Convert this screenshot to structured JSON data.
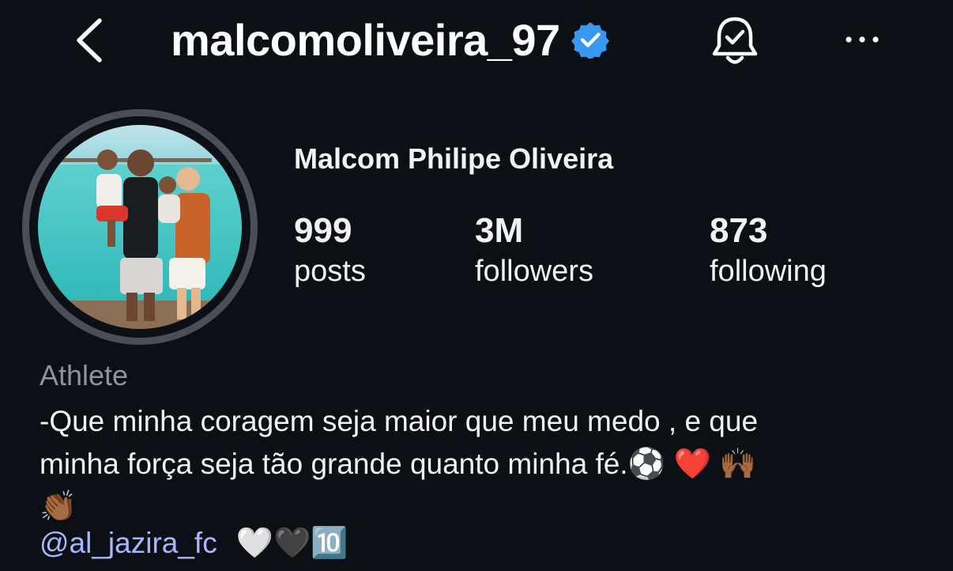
{
  "header": {
    "username": "malcomoliveira_97",
    "verified": true,
    "icons": [
      "back-chevron-icon",
      "verified-badge-icon",
      "notification-bell-check-icon",
      "more-horizontal-icon"
    ]
  },
  "profile": {
    "display_name": "Malcom Philipe Oliveira",
    "stats": {
      "posts": {
        "value": "999",
        "label": "posts"
      },
      "followers": {
        "value": "3M",
        "label": "followers"
      },
      "following": {
        "value": "873",
        "label": "following"
      }
    },
    "category": "Athlete",
    "bio": {
      "line1": "-Que minha coragem seja maior que meu medo , e que",
      "line2": "minha força seja tão grande quanto minha fé.",
      "line2_emojis": "⚽️ ❤️ 🙌🏾",
      "line3_emojis": "👏🏾"
    },
    "link": {
      "mention": "@al_jazira_fc",
      "emojis": "🤍🖤🔟"
    }
  },
  "colors": {
    "background": "#0c0f14",
    "text": "#f2f2f4",
    "secondary_text": "#8e929a",
    "mention": "#a8b6ff",
    "verified": "#3897f0",
    "avatar_ring": "#4a4e57"
  }
}
